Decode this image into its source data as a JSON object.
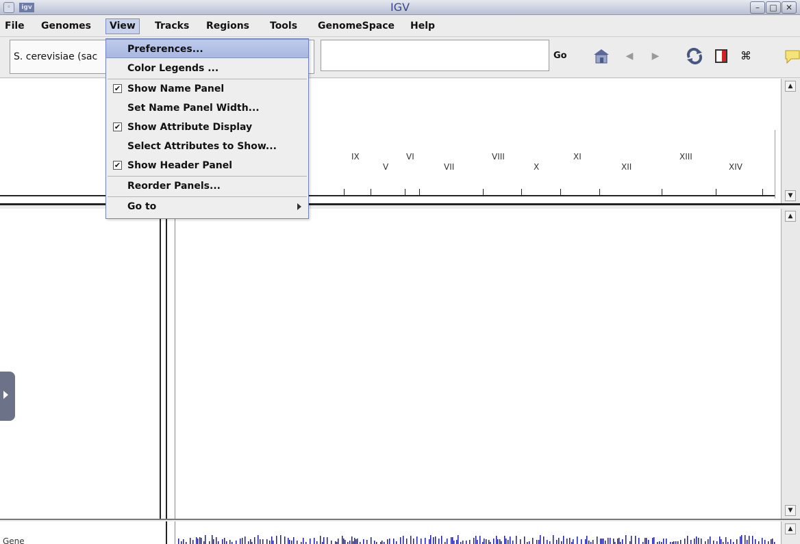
{
  "window": {
    "title": "IGV",
    "app_icon": "igv",
    "controls": {
      "menu_icon": "window-menu-icon",
      "minimize": "–",
      "maximize": "□",
      "close": "✕"
    }
  },
  "menubar": {
    "items": [
      "File",
      "Genomes",
      "View",
      "Tracks",
      "Regions",
      "Tools",
      "GenomeSpace",
      "Help"
    ],
    "active": "View"
  },
  "toolbar": {
    "genome": "S. cerevisiae (sac",
    "locus_value": "",
    "go_label": "Go",
    "icons": [
      "home-icon",
      "back-arrow-icon",
      "forward-arrow-icon",
      "refresh-icon",
      "region-of-interest-icon",
      "fit-to-window-icon",
      "popup-info-icon"
    ]
  },
  "view_menu": {
    "items": [
      {
        "label": "Preferences...",
        "checked": null,
        "highlighted": true
      },
      {
        "label": "Color Legends ...",
        "checked": null
      },
      {
        "label": "Show Name Panel",
        "checked": true
      },
      {
        "label": "Set Name Panel Width...",
        "checked": null
      },
      {
        "label": "Show Attribute Display",
        "checked": true
      },
      {
        "label": "Select Attributes to Show...",
        "checked": null
      },
      {
        "label": "Show Header Panel",
        "checked": true
      },
      {
        "label": "Reorder Panels...",
        "checked": null
      },
      {
        "label": "Go to",
        "checked": null,
        "submenu": true
      }
    ]
  },
  "ideogram": {
    "chromosomes": [
      "IX",
      "V",
      "VI",
      "VII",
      "VIII",
      "X",
      "XI",
      "XII",
      "XIII",
      "XIV"
    ]
  },
  "tracks": {
    "gene_label": "Gene"
  },
  "colors": {
    "menu_highlight": "#b3c1e8",
    "gene_track": "#1a1a9e",
    "title_text": "#38478a"
  }
}
